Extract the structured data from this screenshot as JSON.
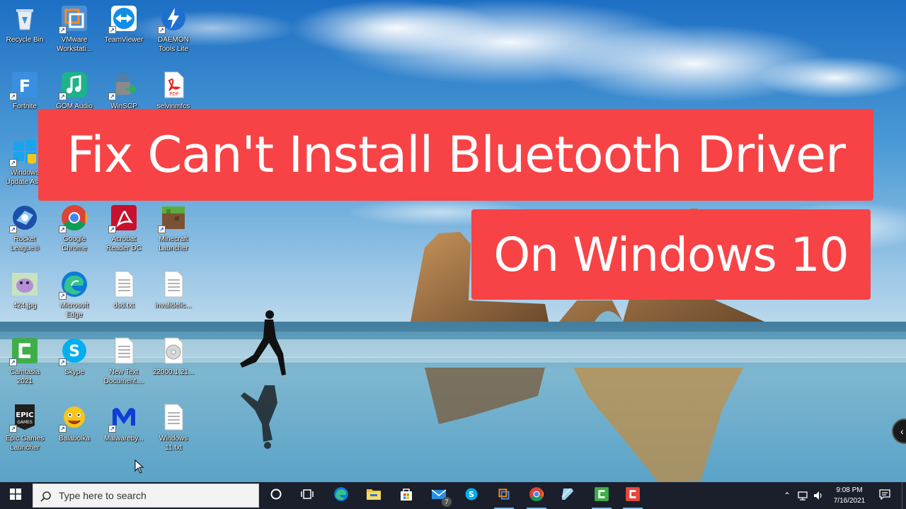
{
  "desktop": {
    "icons": [
      {
        "label": "Recycle Bin",
        "icon": "recycle-bin-icon"
      },
      {
        "label": "VMware Workstati...",
        "icon": "vmware-icon"
      },
      {
        "label": "TeamViewer",
        "icon": "teamviewer-icon"
      },
      {
        "label": "DAEMON Tools Lite",
        "icon": "daemon-tools-icon"
      },
      {
        "label": "Fortnite",
        "icon": "fortnite-icon"
      },
      {
        "label": "GOM Audio",
        "icon": "gom-audio-icon"
      },
      {
        "label": "WinSCP",
        "icon": "winscp-icon"
      },
      {
        "label": "selvinmfcs",
        "icon": "pdf-file-icon"
      },
      {
        "label": "Windows Update As...",
        "icon": "windows-update-icon"
      },
      {
        "label": "Rocket League®",
        "icon": "rocket-league-icon"
      },
      {
        "label": "Google Chrome",
        "icon": "chrome-icon"
      },
      {
        "label": "Acrobat Reader DC",
        "icon": "acrobat-icon"
      },
      {
        "label": "Minecraft Launcher",
        "icon": "minecraft-icon"
      },
      {
        "label": "424.jpg",
        "icon": "image-file-icon"
      },
      {
        "label": "Microsoft Edge",
        "icon": "edge-icon"
      },
      {
        "label": "dsd.txt",
        "icon": "text-file-icon"
      },
      {
        "label": "invalidelic...",
        "icon": "text-file-icon"
      },
      {
        "label": "Camtasia 2021",
        "icon": "camtasia-icon"
      },
      {
        "label": "Skype",
        "icon": "skype-icon"
      },
      {
        "label": "New Text Document....",
        "icon": "text-file-icon"
      },
      {
        "label": "22000.1.21...",
        "icon": "disc-image-icon"
      },
      {
        "label": "Epic Games Launcher",
        "icon": "epic-games-icon"
      },
      {
        "label": "Balabolka",
        "icon": "balabolka-icon"
      },
      {
        "label": "Malwareby...",
        "icon": "malwarebytes-icon"
      },
      {
        "label": "Windows 11.txt",
        "icon": "text-file-icon"
      }
    ]
  },
  "banner": {
    "title": "Fix Can't Install Bluetooth Driver",
    "subtitle": "On Windows 10"
  },
  "taskbar": {
    "search_placeholder": "Type here to search",
    "apps": [
      {
        "name": "cortana-icon"
      },
      {
        "name": "task-view-icon"
      },
      {
        "name": "edge-icon"
      },
      {
        "name": "file-explorer-icon"
      },
      {
        "name": "microsoft-store-icon"
      },
      {
        "name": "mail-icon",
        "badge": "7"
      },
      {
        "name": "skype-icon"
      },
      {
        "name": "vmware-icon"
      },
      {
        "name": "chrome-icon"
      },
      {
        "name": "notepad-icon"
      },
      {
        "name": "camtasia-icon"
      },
      {
        "name": "camtasia-recorder-icon"
      }
    ],
    "clock": {
      "time": "9:08 PM",
      "date": "7/16/2021"
    }
  },
  "colors": {
    "banner": "#f74346",
    "taskbar": "#1a1f2b",
    "sky_top": "#1d6fc4",
    "sea": "#5aa3c8"
  }
}
